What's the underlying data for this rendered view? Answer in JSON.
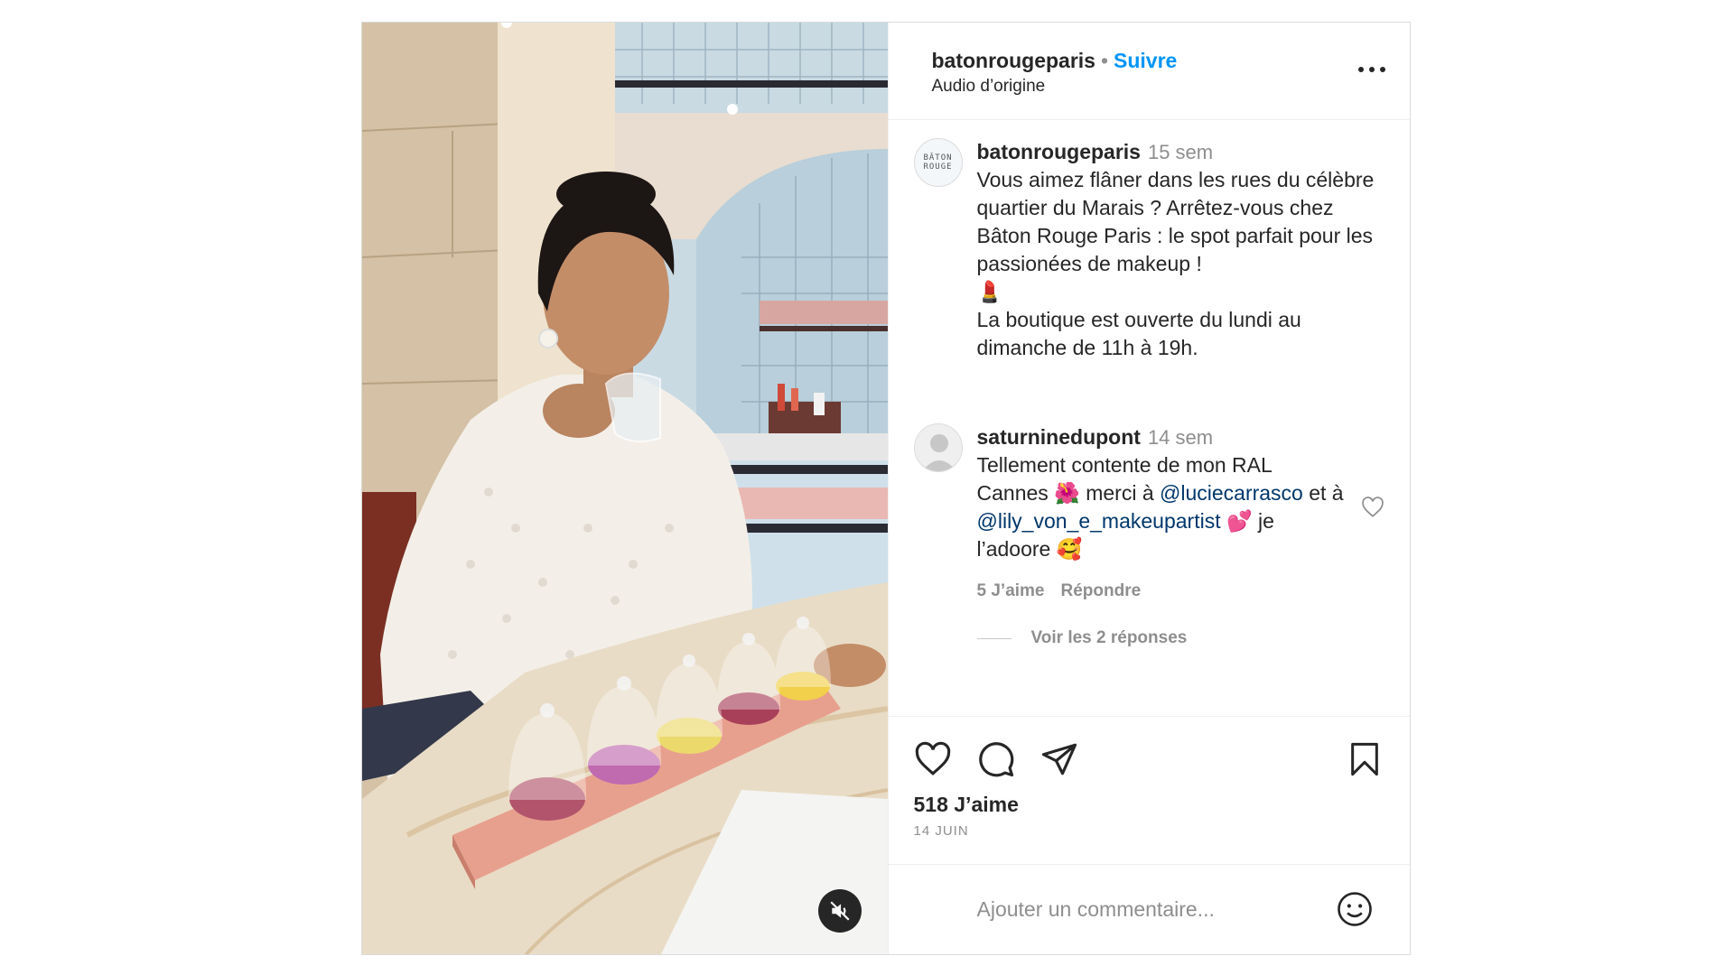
{
  "post": {
    "author": "batonrougeparis",
    "separator": "•",
    "follow_label": "Suivre",
    "audio_label": "Audio d’origine",
    "avatar_text_top": "BÂTON",
    "avatar_text_bottom": "ROUGE"
  },
  "caption": {
    "username": "batonrougeparis",
    "time": "15 sem",
    "text_line1": "Vous aimez flâner dans les rues du célèbre quartier du Marais ? Arrêtez-vous chez Bâton Rouge Paris : le spot parfait pour les passionées de makeup !",
    "emoji": "💄",
    "text_line2": "La boutique est ouverte du lundi au dimanche de 11h à 19h."
  },
  "comment": {
    "username": "saturninedupont",
    "time": "14 sem",
    "text_a": "Tellement contente de mon RAL Cannes ",
    "emoji_a": "🌺",
    "text_b": " merci à ",
    "mention_1": "@luciecarrasco",
    "text_c": " et à ",
    "mention_2": "@lily_von_e_makeupartist",
    "emoji_b": " 💕",
    "text_d": " je l’adoore ",
    "emoji_c": "🥰",
    "likes": "5 J’aime",
    "reply_label": "Répondre",
    "view_replies": "Voir les 2 réponses"
  },
  "actions": {
    "icons": [
      "heart-icon",
      "comment-icon",
      "share-icon",
      "bookmark-icon"
    ],
    "likes_count": "518 J’aime",
    "date": "14 JUIN"
  },
  "composer": {
    "placeholder": "Ajouter un commentaire..."
  },
  "media": {
    "mute_icon": "speaker-muted-icon"
  },
  "colors": {
    "accent": "#0095f6",
    "mention": "#00376b",
    "muted_text": "#8e8e8e",
    "border": "#dbdbdb"
  }
}
